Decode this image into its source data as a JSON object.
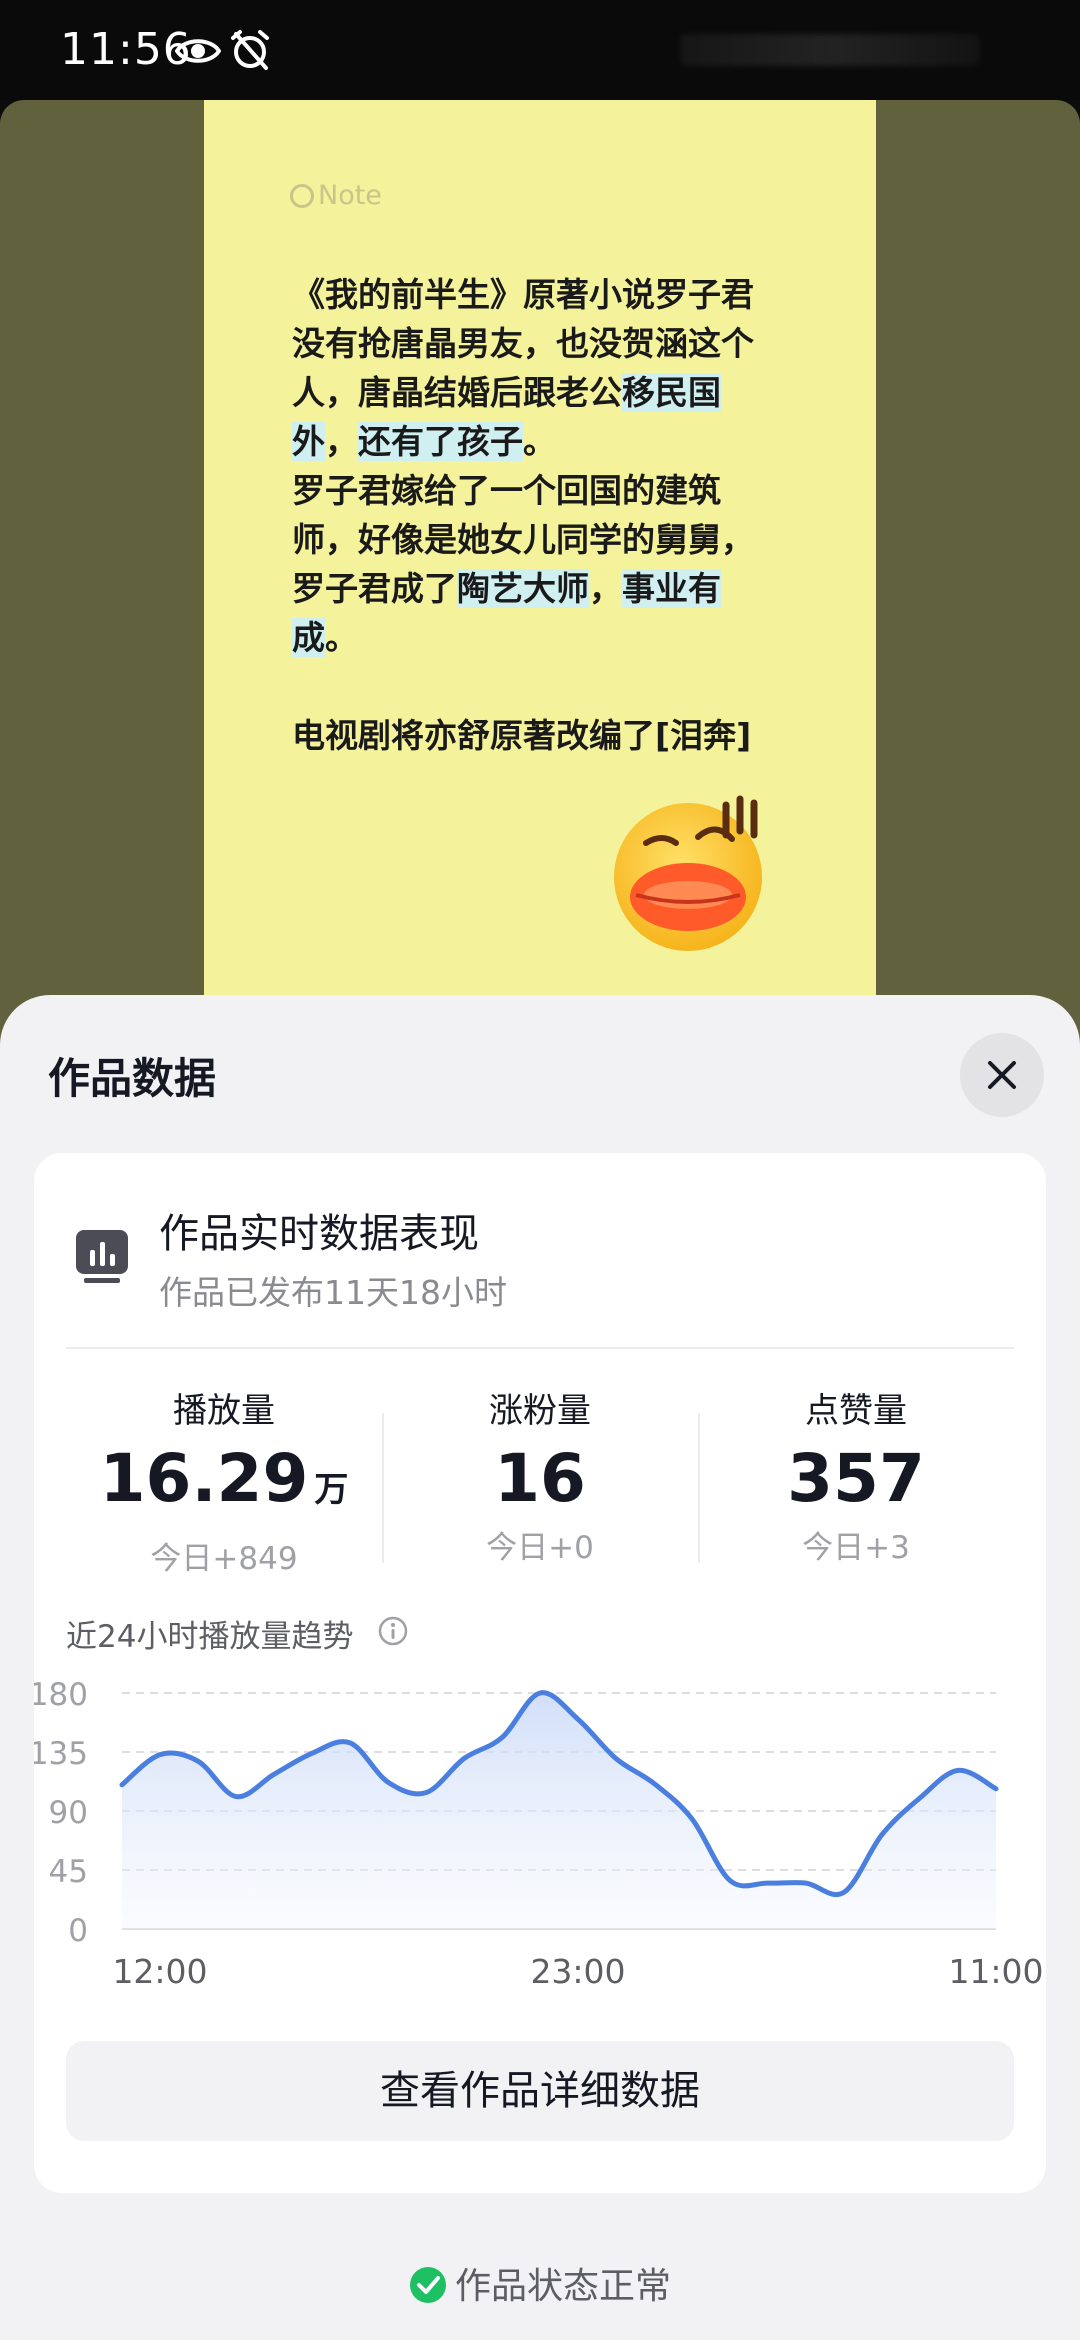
{
  "status_bar": {
    "time": "11:56"
  },
  "video": {
    "note_header": "Note",
    "note_lines": [
      [
        {
          "t": "《我的前半生》原著小说罗子君"
        }
      ],
      [
        {
          "t": "没有抢唐晶男友，也没贺涵这个"
        }
      ],
      [
        {
          "t": "人，唐晶结婚后跟老公"
        },
        {
          "t": "移民国",
          "hl": true
        }
      ],
      [
        {
          "t": "外",
          "hl": true
        },
        {
          "t": "，"
        },
        {
          "t": "还有了孩子",
          "hl": true
        },
        {
          "t": "。"
        }
      ],
      [
        {
          "t": "罗子君嫁给了一个回国的建筑"
        }
      ],
      [
        {
          "t": "师，好像是她女儿同学的舅舅，"
        }
      ],
      [
        {
          "t": "罗子君成了"
        },
        {
          "t": "陶艺大师",
          "hl": true
        },
        {
          "t": "，"
        },
        {
          "t": "事业有",
          "hl": true
        }
      ],
      [
        {
          "t": "成",
          "hl": true
        },
        {
          "t": "。"
        }
      ],
      [
        {
          "t": ""
        }
      ],
      [
        {
          "t": "电视剧将亦舒原著改编了[泪奔]"
        }
      ]
    ]
  },
  "sheet": {
    "title": "作品数据",
    "close_icon": "close-icon",
    "card": {
      "title": "作品实时数据表现",
      "subtitle": "作品已发布11天18小时",
      "icon": "bar-chart-icon"
    },
    "stats": [
      {
        "label": "播放量",
        "value": "16.29",
        "unit": "万",
        "today": "今日+849"
      },
      {
        "label": "涨粉量",
        "value": "16",
        "unit": "",
        "today": "今日+0"
      },
      {
        "label": "点赞量",
        "value": "357",
        "unit": "",
        "today": "今日+3"
      }
    ],
    "trend_title": "近24小时播放量趋势",
    "detail_button": "查看作品详细数据",
    "status_text": "作品状态正常",
    "accent_color": "#4a7fe0",
    "ok_color": "#1fbf63"
  },
  "chart_data": {
    "type": "area",
    "title": "近24小时播放量趋势",
    "xlabel": "",
    "ylabel": "",
    "ylim": [
      0,
      180
    ],
    "yticks": [
      0,
      45,
      90,
      135,
      180
    ],
    "xtick_labels": [
      "12:00",
      "23:00",
      "11:00"
    ],
    "xtick_index": [
      1,
      12,
      23
    ],
    "grid": true,
    "series": [
      {
        "values": [
          110,
          133,
          128,
          101,
          118,
          134,
          142,
          112,
          104,
          130,
          146,
          180,
          160,
          130,
          111,
          84,
          37,
          35,
          35,
          28,
          72,
          100,
          121,
          107
        ]
      }
    ]
  }
}
